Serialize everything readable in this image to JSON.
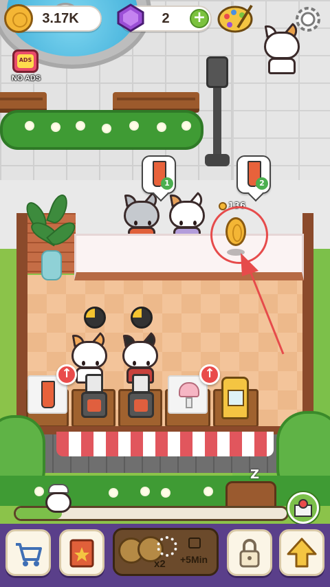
{
  "hud": {
    "coins": "3.17K",
    "gems": "2",
    "gems_plus": "+",
    "noads_badge": "ADS",
    "noads_label": "NO ADS"
  },
  "orders": [
    {
      "count": "1"
    },
    {
      "count": "2"
    }
  ],
  "coin_pickup": {
    "amount": "136"
  },
  "upgrade_badges": [
    "↑",
    "↑"
  ],
  "idle_indicator": "Z",
  "progress": {
    "fraction": 0.17
  },
  "boost": {
    "multiplier": "x2",
    "duration": "+5Min"
  },
  "bottom_tabs": [
    {
      "icon": "cart-icon"
    },
    {
      "icon": "book-icon"
    },
    {
      "icon": "lock-icon"
    },
    {
      "icon": "arrow-up-icon"
    }
  ],
  "colors": {
    "bottom_bar": "#5a3f8a",
    "coin": "#f4b635",
    "plus_green": "#7bc23e",
    "highlight_red": "#e64b4b"
  }
}
